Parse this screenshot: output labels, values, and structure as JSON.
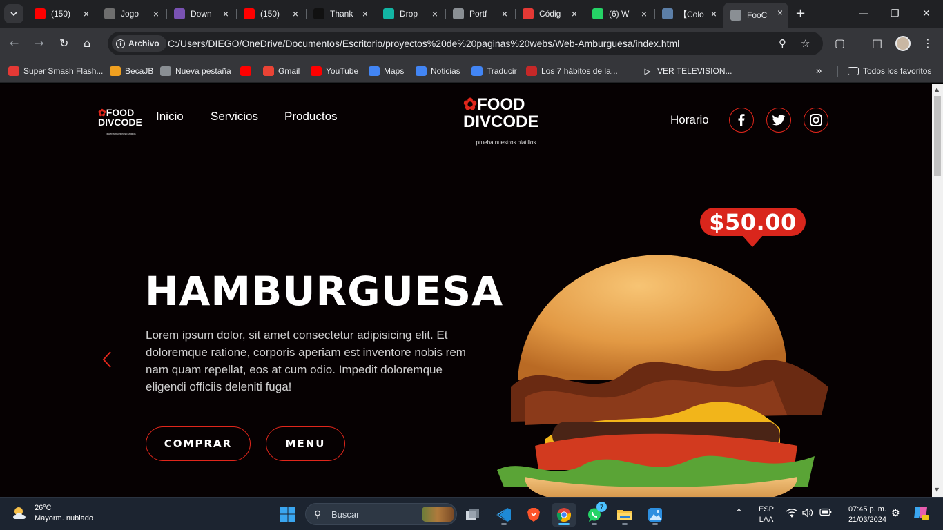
{
  "browser": {
    "tabs": [
      {
        "title": "(150)",
        "icon": "youtube-icon",
        "color": "#ff0000"
      },
      {
        "title": "Jogo",
        "icon": "openai-icon",
        "color": "#6e6e6e"
      },
      {
        "title": "Down",
        "icon": "bootstrap-icon",
        "color": "#7952b3"
      },
      {
        "title": "(150)",
        "icon": "youtube-icon",
        "color": "#ff0000"
      },
      {
        "title": "Thank",
        "icon": "thankyou-icon",
        "color": "#111111"
      },
      {
        "title": "Drop",
        "icon": "dropshipping-icon",
        "color": "#12b5a4"
      },
      {
        "title": "Portf",
        "icon": "globe-icon",
        "color": "#8a8f94"
      },
      {
        "title": "Códig",
        "icon": "codigo-icon",
        "color": "#e53935"
      },
      {
        "title": "(6) W",
        "icon": "whatsapp-icon",
        "color": "#25d366"
      },
      {
        "title": "【Colo",
        "icon": "colombia-icon",
        "color": "#5c7fa8"
      },
      {
        "title": "FooC",
        "icon": "globe-icon",
        "color": "#8a8f94"
      }
    ],
    "chip_label": "Archivo",
    "url": "C:/Users/DIEGO/OneDrive/Documentos/Escritorio/proyectos%20de%20paginas%20webs/Web-Amburguesa/index.html",
    "bookmarks": [
      {
        "label": "Super Smash Flash...",
        "icon": "ssf-icon",
        "color": "#e53935"
      },
      {
        "label": "BecaJB",
        "icon": "becajb-icon",
        "color": "#f0a020"
      },
      {
        "label": "Nueva pestaña",
        "icon": "globe-icon",
        "color": "#8a8f94"
      },
      {
        "label": "",
        "icon": "youtube-icon",
        "color": "#ff0000"
      },
      {
        "label": "Gmail",
        "icon": "gmail-icon",
        "color": "#ea4335"
      },
      {
        "label": "YouTube",
        "icon": "youtube-icon",
        "color": "#ff0000"
      },
      {
        "label": "Maps",
        "icon": "google-icon",
        "color": "#4285f4"
      },
      {
        "label": "Noticias",
        "icon": "news-icon",
        "color": "#4285f4"
      },
      {
        "label": "Traducir",
        "icon": "translate-icon",
        "color": "#4285f4"
      },
      {
        "label": "Los 7 hábitos de la...",
        "icon": "pdf-icon",
        "color": "#c62828"
      },
      {
        "label": "VER TELEVISION...",
        "icon": "play-icon",
        "color": "#35363a"
      }
    ],
    "all_bookmarks_label": "Todos los favoritos"
  },
  "page": {
    "logo_line1": "FOOD",
    "logo_line2": "DIVCODE",
    "logo_tagline": "prueba nuestros platillos",
    "nav": [
      "Inicio",
      "Servicios",
      "Productos"
    ],
    "horario": "Horario",
    "price": "$50.00",
    "hero_title": "HAMBURGUESA",
    "hero_text": "Lorem ipsum dolor, sit amet consectetur adipisicing elit. Et doloremque ratione, corporis aperiam est inventore nobis rem nam quam repellat, eos at cum odio. Impedit doloremque eligendi officiis deleniti fuga!",
    "btn_buy": "COMPRAR",
    "btn_menu": "MENU",
    "accent": "#e0261b"
  },
  "taskbar": {
    "temp": "26°C",
    "weather": "Mayorm. nublado",
    "search_placeholder": "Buscar",
    "whatsapp_badge": "7",
    "lang1": "ESP",
    "lang2": "LAA",
    "time": "07:45 p. m.",
    "date": "21/03/2024"
  }
}
